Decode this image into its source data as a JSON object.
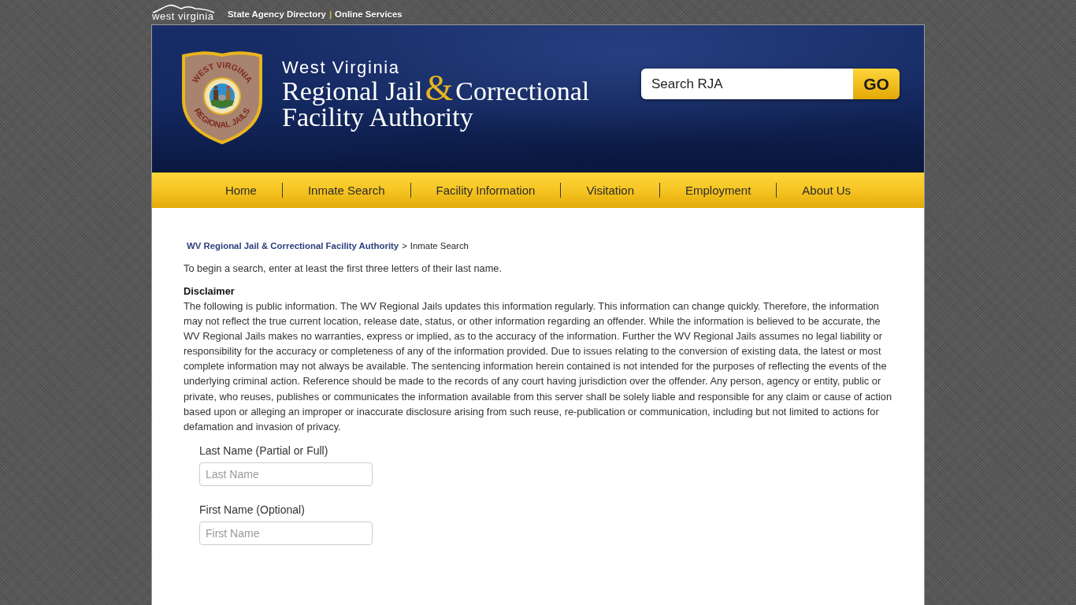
{
  "top_bar": {
    "logo_text": "west virginia",
    "links": [
      "State Agency Directory",
      "Online Services"
    ],
    "separator": "|"
  },
  "header": {
    "badge": {
      "top_text": "WEST VIRGINIA",
      "bottom_text": "REGIONAL JAILS"
    },
    "state_name": "West Virginia",
    "title": {
      "line_1_start": "Regional Jail",
      "ampersand": "&",
      "line_1_end": "Correctional",
      "line_2": "Facility Authority"
    },
    "search": {
      "value": "Search RJA",
      "button": "GO"
    }
  },
  "nav": {
    "items": [
      "Home",
      "Inmate Search",
      "Facility Information",
      "Visitation",
      "Employment",
      "About Us"
    ]
  },
  "breadcrumb": {
    "link": "WV Regional Jail & Correctional Facility Authority",
    "separator": ">",
    "current": "Inmate Search"
  },
  "intro": "To begin a search, enter at least the first three letters of their last name.",
  "disclaimer": {
    "heading": "Disclaimer",
    "text": "The following is public information. The WV Regional Jails updates this information regularly. This information can change quickly. Therefore, the information may not reflect the true current location, release date, status, or other information regarding an offender. While the information is believed to be accurate, the WV Regional Jails makes no warranties, express or implied, as to the accuracy of the information. Further the WV Regional Jails assumes no legal liability or responsibility for the accuracy or completeness of any of the information provided. Due to issues relating to the conversion of existing data, the latest or most complete information may not always be available. The sentencing information herein contained is not intended for the purposes of reflecting the events of the underlying criminal action. Reference should be made to the records of any court having jurisdiction over the offender. Any person, agency or entity, public or private, who reuses, publishes or communicates the information available from this server shall be solely liable and responsible for any claim or cause of action based upon or alleging an improper or inaccurate disclosure arising from such reuse, re-publication or communication, including but not limited to actions for defamation and invasion of privacy."
  },
  "form": {
    "fields": [
      {
        "label": "Last Name (Partial or Full)",
        "placeholder": "Last Name"
      },
      {
        "label": "First Name (Optional)",
        "placeholder": "First Name"
      }
    ]
  }
}
